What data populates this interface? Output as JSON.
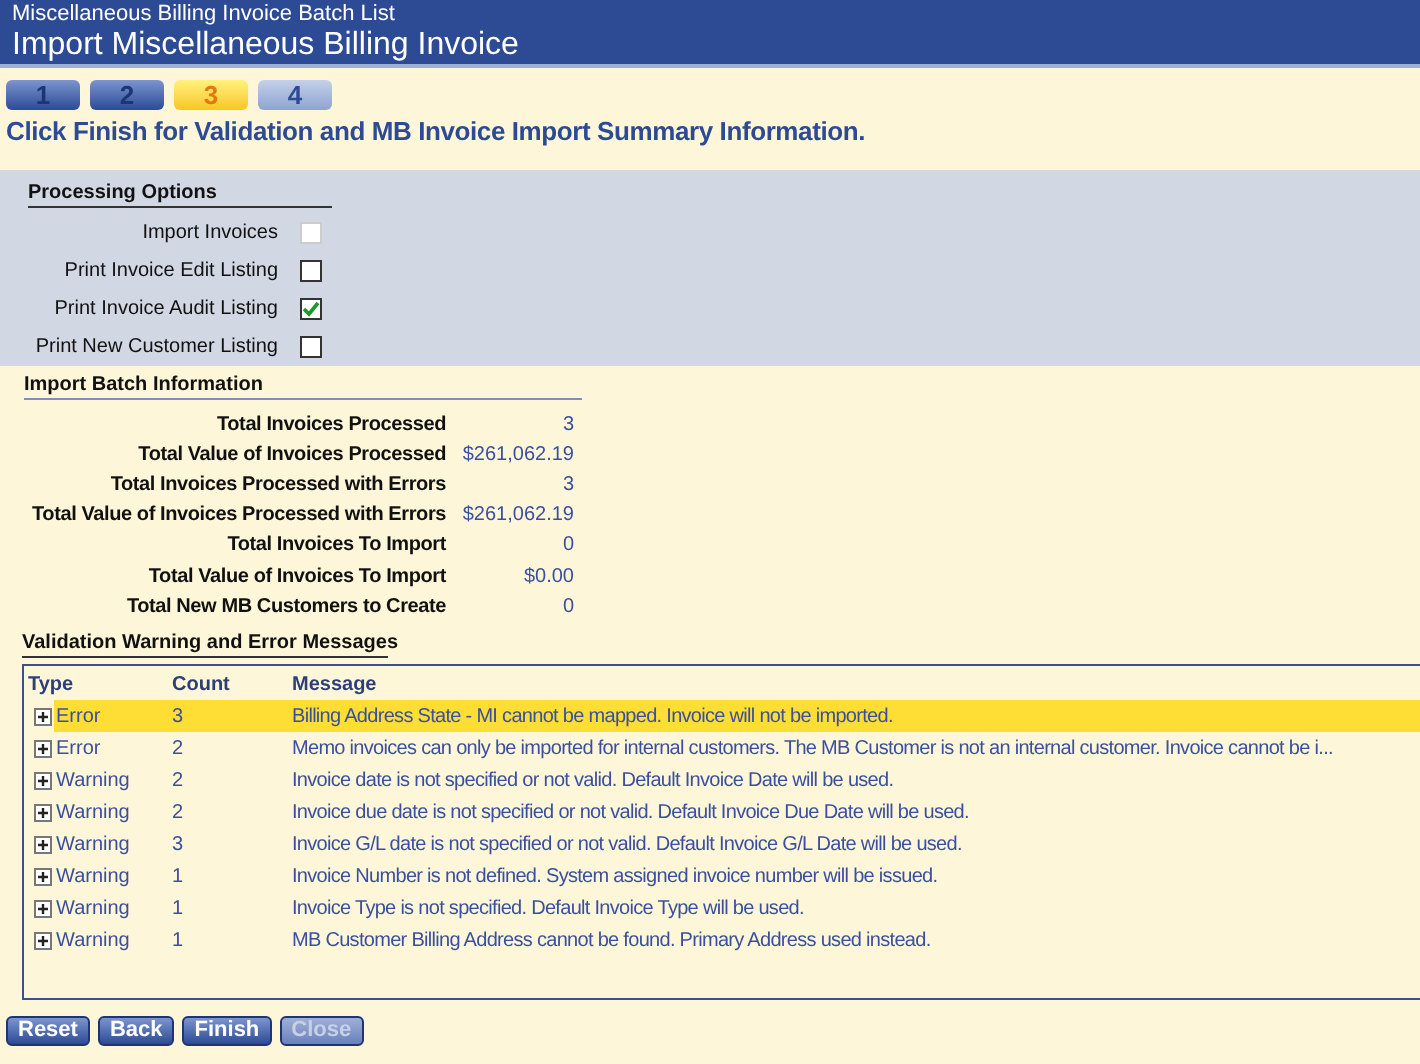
{
  "header": {
    "breadcrumb": "Miscellaneous Billing Invoice Batch List",
    "title": "Import Miscellaneous Billing Invoice"
  },
  "steps": [
    {
      "label": "1",
      "selected": false
    },
    {
      "label": "2",
      "selected": false
    },
    {
      "label": "3",
      "selected": true
    },
    {
      "label": "4",
      "selected": false,
      "disabled": true
    }
  ],
  "instruction": "Click Finish for Validation and MB Invoice Import Summary Information.",
  "processing_options": {
    "title": "Processing Options",
    "items": [
      {
        "label": "Import Invoices",
        "checked": false,
        "disabled": true
      },
      {
        "label": "Print Invoice Edit Listing",
        "checked": false,
        "disabled": false
      },
      {
        "label": "Print Invoice Audit Listing",
        "checked": true,
        "disabled": false
      },
      {
        "label": "Print New Customer Listing",
        "checked": false,
        "disabled": false
      }
    ]
  },
  "batch_info": {
    "title": "Import Batch Information",
    "rows": [
      {
        "label": "Total Invoices Processed",
        "value": "3"
      },
      {
        "label": "Total Value of Invoices Processed",
        "value": "$261,062.19"
      },
      {
        "label": "Total Invoices Processed with Errors",
        "value": "3"
      },
      {
        "label": "Total Value of Invoices Processed with Errors",
        "value": "$261,062.19"
      },
      {
        "label": "Total Invoices To Import",
        "value": "0"
      },
      {
        "label": "Total Value of Invoices To Import",
        "value": "$0.00"
      },
      {
        "label": "Total New MB Customers to Create",
        "value": "0"
      }
    ]
  },
  "messages": {
    "title": "Validation Warning and Error Messages",
    "columns": [
      "Type",
      "Count",
      "Message"
    ],
    "rows": [
      {
        "type": "Error",
        "count": "3",
        "message": "Billing Address State - MI cannot be mapped. Invoice will not be imported.",
        "selected": true
      },
      {
        "type": "Error",
        "count": "2",
        "message": "Memo invoices can only be imported for internal customers. The MB Customer is not an internal customer. Invoice cannot be i...",
        "selected": false
      },
      {
        "type": "Warning",
        "count": "2",
        "message": "Invoice date is not specified or not valid. Default Invoice Date will be used.",
        "selected": false
      },
      {
        "type": "Warning",
        "count": "2",
        "message": "Invoice due date is not specified or not valid. Default Invoice Due Date will be used.",
        "selected": false
      },
      {
        "type": "Warning",
        "count": "3",
        "message": "Invoice G/L date is not specified or not valid. Default Invoice G/L Date will be used.",
        "selected": false
      },
      {
        "type": "Warning",
        "count": "1",
        "message": "Invoice Number is not defined. System assigned invoice number will be issued.",
        "selected": false
      },
      {
        "type": "Warning",
        "count": "1",
        "message": "Invoice Type is not specified. Default Invoice Type will be used.",
        "selected": false
      },
      {
        "type": "Warning",
        "count": "1",
        "message": "MB Customer Billing Address cannot be found. Primary Address used instead.",
        "selected": false
      }
    ]
  },
  "buttons": [
    {
      "label": "Reset",
      "disabled": false
    },
    {
      "label": "Back",
      "disabled": false
    },
    {
      "label": "Finish",
      "disabled": false
    },
    {
      "label": "Close",
      "disabled": true
    }
  ]
}
